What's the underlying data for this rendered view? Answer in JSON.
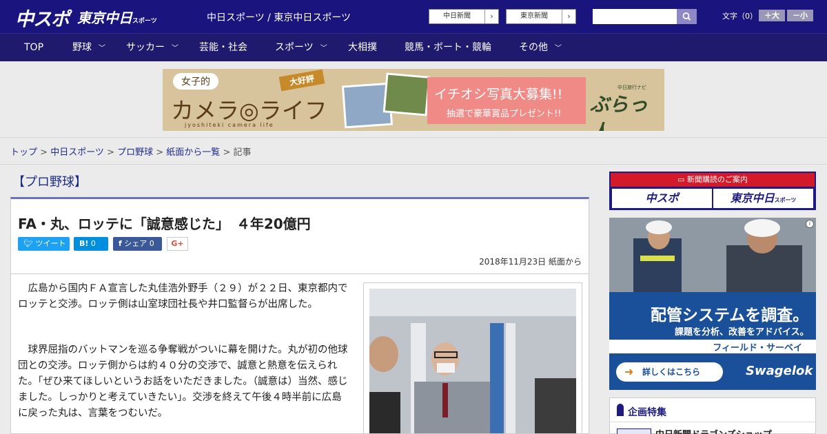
{
  "header": {
    "logo_chunichi_sports": "中スポ",
    "logo_tokyo_chunichi": "東京中日",
    "logo_tokyo_chunichi_sub": "スポーツ",
    "site_names": "中日スポーツ / 東京中日スポーツ",
    "newspaper_links": [
      {
        "label": "中日新聞",
        "arrow": "›"
      },
      {
        "label": "東京新聞",
        "arrow": "›"
      }
    ],
    "search_placeholder": "",
    "font_size_label": "文字（0）",
    "font_larger": "＋大",
    "font_smaller": "－小"
  },
  "nav": [
    {
      "label": "TOP",
      "has_dropdown": false
    },
    {
      "label": "野球",
      "has_dropdown": true
    },
    {
      "label": "サッカー",
      "has_dropdown": true
    },
    {
      "label": "芸能・社会",
      "has_dropdown": false
    },
    {
      "label": "スポーツ",
      "has_dropdown": true
    },
    {
      "label": "大相撲",
      "has_dropdown": false
    },
    {
      "label": "競馬・ボート・競輪",
      "has_dropdown": false
    },
    {
      "label": "その他",
      "has_dropdown": true
    }
  ],
  "banner": {
    "tag": "女子的",
    "main": "カメラ◎ライフ",
    "sub": "jyoshiteki camera life",
    "flag": "大好評",
    "line1": "イチオシ写真大募集!!",
    "line2": "抽選で豪華賞品プレゼント!!",
    "brand_small": "中日旅行ナビ",
    "brand": "ぶらっ人"
  },
  "breadcrumb": {
    "items": [
      "トップ",
      "中日スポーツ",
      "プロ野球",
      "紙面から一覧"
    ],
    "current": "記事",
    "separator": " > "
  },
  "article": {
    "category": "【プロ野球】",
    "title": "FA・丸、ロッテに「誠意感じた」　４年20億円",
    "share": {
      "tweet": "ツイート",
      "hatena_count": "0",
      "facebook": "シェア",
      "facebook_count": "0",
      "gplus": "G+"
    },
    "date_source": "2018年11月23日 紙面から",
    "paragraphs": [
      "　広島から国内ＦＡ宣言した丸佳浩外野手（２９）が２２日、東京都内でロッテと交渉。ロッテ側は山室球団社長や井口監督らが出席した。",
      "　球界屈指のバットマンを巡る争奪戦がついに幕を開けた。丸が初の他球団との交渉。ロッテ側からは約４０分の交渉で、誠意と熱意を伝えられた。「ぜひ来てほしいというお話をいただきました。（誠意は）当然、感じました。しっかりと考えていきたい」。交渉を終えて午後４時半前に広島に戻った丸は、言葉をつむいだ。"
    ]
  },
  "sidebar": {
    "subscribe_header": "新聞購読のご案内",
    "subscribe_links": [
      "中スポ",
      "東京中日"
    ],
    "subscribe_link2_sub": "スポーツ",
    "ad": {
      "headline": "配管システムを調査。",
      "subline": "課題を分析、改善をアドバイス。",
      "band": "フィールド・サーベイ",
      "cta": "詳しくはこちら",
      "cta_arrow": "➜",
      "brand": "Swagelok",
      "info": "i"
    },
    "feature": {
      "title": "企画特集",
      "item": "中日新聞ドラゴンズショップ"
    }
  },
  "colors": {
    "header_bg": "#19147e",
    "nav_bg": "#201a6e",
    "accent_link": "#1f2c8c",
    "twitter": "#1da1f2",
    "hatena": "#008fde",
    "facebook": "#3b5998",
    "subscribe_red": "#d21a2a"
  }
}
